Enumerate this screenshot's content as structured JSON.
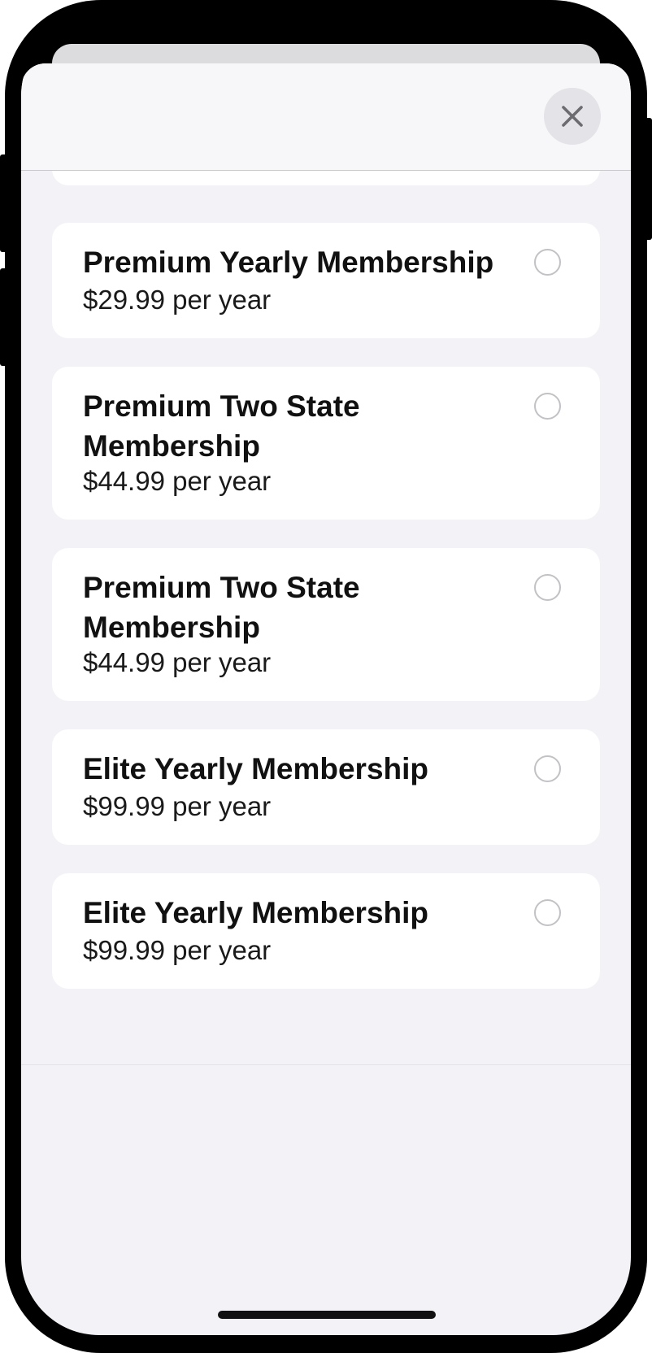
{
  "header": {
    "close_icon": "close-x-icon"
  },
  "plans": [
    {
      "title": "Premium Yearly Membership",
      "price": "$29.99 per year",
      "selected": false
    },
    {
      "title": "Premium Two State Membership",
      "price": "$44.99 per year",
      "selected": false
    },
    {
      "title": "Premium Two State Membership",
      "price": "$44.99 per year",
      "selected": false
    },
    {
      "title": "Elite Yearly Membership",
      "price": "$99.99 per year",
      "selected": false
    },
    {
      "title": "Elite Yearly Membership",
      "price": "$99.99 per year",
      "selected": false
    }
  ],
  "colors": {
    "background": "#f2f2f7",
    "card": "#ffffff",
    "radio_border": "#c2c2c6",
    "close_button": "#e4e4e8"
  }
}
